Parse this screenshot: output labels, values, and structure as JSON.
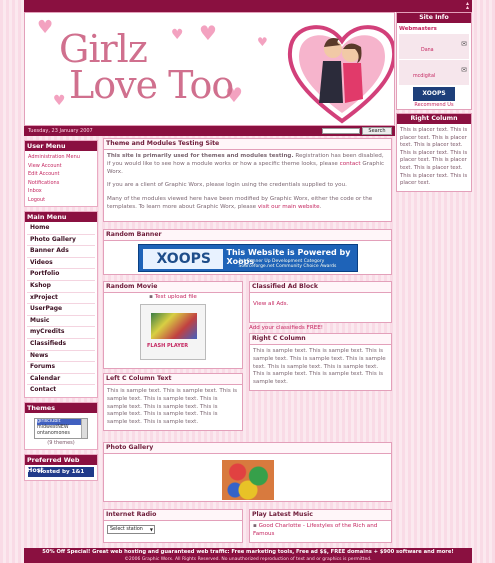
{
  "header": {
    "logo_line1": "Girlz",
    "logo_line2": "Love Too",
    "date": "Tuesday, 23 January 2007",
    "search_button": "Search"
  },
  "user_menu": {
    "title": "User Menu",
    "items": [
      "Administration Menu",
      "View Account",
      "Edit Account",
      "Notifications",
      "Inbox",
      "Logout"
    ]
  },
  "main_menu": {
    "title": "Main Menu",
    "items": [
      "Home",
      "Photo Gallery",
      "Banner Ads",
      "Videos",
      "Portfolio",
      "Kshop",
      "xProject",
      "UserPage",
      "Music",
      "myCredits",
      "Classifieds",
      "News",
      "Forums",
      "Calendar",
      "Contact"
    ]
  },
  "themes": {
    "title": "Themes",
    "options": [
      "girlsclubit",
      "midwestNEW",
      "ontanomones"
    ],
    "count": "(9 themes)"
  },
  "web_host": {
    "title": "Preferred Web Host",
    "banner": "Hosted by 1&1"
  },
  "testing_site": {
    "title": "Theme and Modules Testing Site",
    "para1_bold": "This site is primarily used for themes and modules testing.",
    "para1_rest": " Registration has been disabled, if you would like to see how a module works or how a specific theme looks, please ",
    "para1_link": "contact",
    "para1_end": " Graphic Worx.",
    "para2": "If you are a client of Graphic Worx, please login using the credentials supplied to you.",
    "para3": "Many of the modules viewed here have been modified by Graphic Worx, either the code or the templates. To learn more about Graphic Worx, please ",
    "para3_link": "visit our main website",
    "para3_end": "."
  },
  "random_banner": {
    "title": "Random Banner",
    "banner_logo": "XOOPS",
    "banner_headline": "This Website is Powered by Xoops",
    "banner_sub": "1st Runner Up Development Category Sourceforge.net Community Choice Awards"
  },
  "random_movie": {
    "title": "Random Movie",
    "link": "Test upload file",
    "player": "FLASH PLAYER"
  },
  "classified": {
    "title": "Classified Ad Block",
    "link": "View all Ads.",
    "add": "Add your classifieds FREE!"
  },
  "right_c": {
    "title": "Right C Column",
    "text": "This is sample text. This is sample text. This is sample text. This is sample text. This is sample text. This is sample text. This is sample text. This is sample text. This is sample text. This is sample text."
  },
  "left_c": {
    "title": "Left C Column Text",
    "text": "This is sample text. This is sample text. This is sample text. This is sample text. This is sample text. This is sample text. This is sample text. This is sample text. This is sample text. This is sample text."
  },
  "photo_gallery": {
    "title": "Photo Gallery"
  },
  "internet_radio": {
    "title": "Internet Radio",
    "select": "Select station"
  },
  "music": {
    "title": "Play Latest Music",
    "item": "Good Charlotte - Lifestyles of the Rich and Famous"
  },
  "site_info": {
    "title": "Site Info",
    "webmasters_label": "Webmasters",
    "webmasters": [
      "Dana",
      "mcdigital"
    ],
    "badge": "XOOPS",
    "recommend": "Recommend Us"
  },
  "right_column": {
    "title": "Right Column",
    "text": "This is placer text. This is placer text. This is placer text. This is placer text. This is placer text. This is placer text. This is placer text. This is placer text. This is placer text. This is placer text."
  },
  "footer": {
    "promo": "50% Off Special! Great web hosting and guaranteed web traffic: Free marketing tools, Free ad $$, FREE domains + $900 software and more!",
    "copyright": "©2006 Graphic Worx. All Rights Reserved. No unauthorized reproduction of text and or graphics is permitted."
  },
  "colors": {
    "accent": "#8a1040",
    "link": "#c4255f",
    "logo": "#d0708e"
  }
}
